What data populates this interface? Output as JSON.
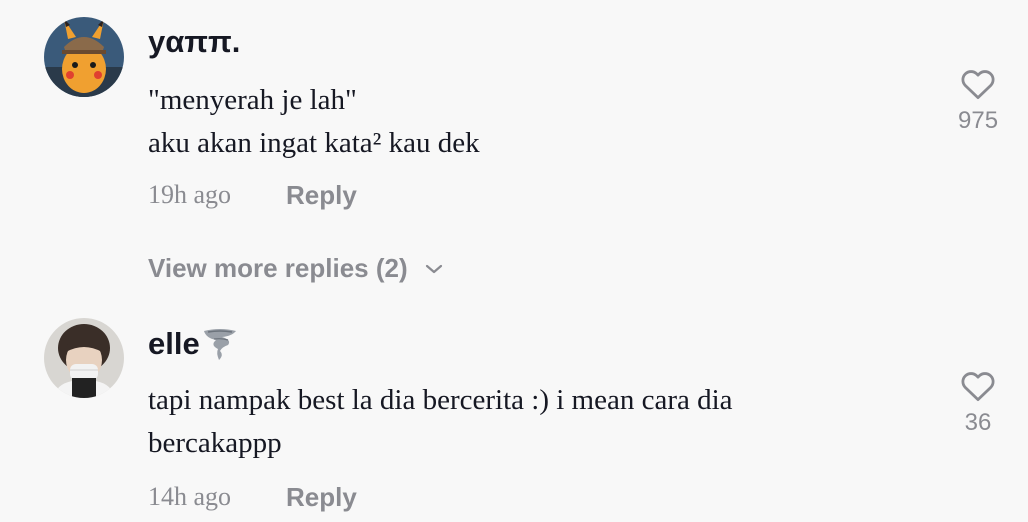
{
  "comments": [
    {
      "username": "yαππ.",
      "text_lines": [
        "\"menyerah je lah\"",
        "aku akan ingat kata² kau dek"
      ],
      "time": "19h ago",
      "reply_label": "Reply",
      "like_count": "975",
      "avatar_icon": "pikachu-detective-avatar"
    },
    {
      "username": "elle",
      "username_emoji_icon": "tornado-icon",
      "text_lines": [
        "tapi nampak best la dia bercerita :) i mean cara dia",
        "bercakappp"
      ],
      "time": "14h ago",
      "reply_label": "Reply",
      "like_count": "36",
      "avatar_icon": "masked-person-avatar"
    }
  ],
  "view_more_replies": "View more replies (2)",
  "colors": {
    "background": "#f8f8f8",
    "primary_text": "#161823",
    "secondary_text": "#8a8b91"
  }
}
